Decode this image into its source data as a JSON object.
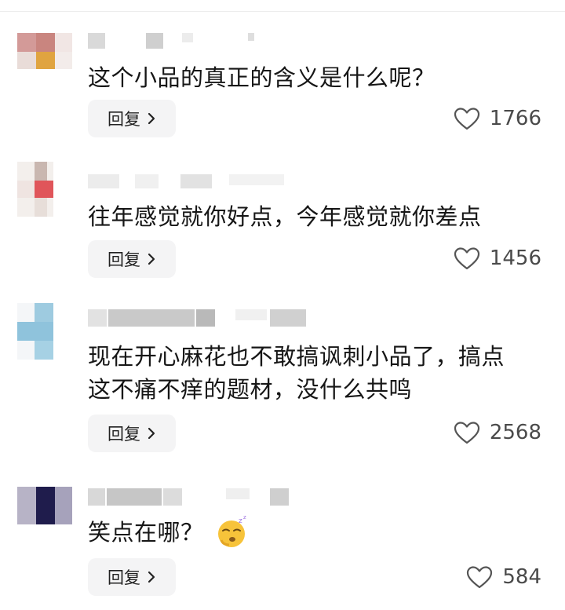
{
  "comments": [
    {
      "text_lines": [
        "这个小品的真正的含义是什么呢？"
      ],
      "reply_label": "回复",
      "likes": "1766"
    },
    {
      "text_lines": [
        "往年感觉就你好点，今年感觉就你差点"
      ],
      "reply_label": "回复",
      "likes": "1456"
    },
    {
      "text_lines": [
        "现在开心麻花也不敢搞讽刺小品了，搞点",
        "这不痛不痒的题材，没什么共鸣"
      ],
      "reply_label": "回复",
      "likes": "2568"
    },
    {
      "text_lines": [
        "笑点在哪？"
      ],
      "reply_label": "回复",
      "likes": "584",
      "emoji": "sleepy-face-emoji"
    }
  ],
  "icons": {
    "like": "heart-outline-icon",
    "reply_chevron": "chevron-right-icon"
  },
  "colors": {
    "reply_bg": "#f4f4f5",
    "text": "#161616",
    "meta": "#4a4a4a"
  }
}
